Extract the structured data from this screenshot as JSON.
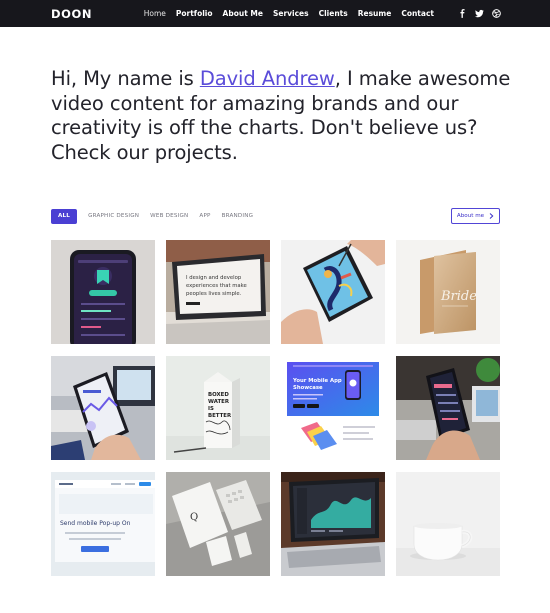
{
  "brand": {
    "logo": "DOON"
  },
  "nav": {
    "links": [
      "Home",
      "Portfolio",
      "About Me",
      "Services",
      "Clients",
      "Resume",
      "Contact"
    ],
    "social": [
      "facebook-icon",
      "twitter-icon",
      "dribbble-icon"
    ]
  },
  "hero": {
    "prefix": "Hi, My name is ",
    "name": "David Andrew",
    "suffix": ", I make awesome video content for amazing brands and our creativity is off the charts. Don't believe us? Check our projects."
  },
  "filters": {
    "items": [
      "ALL",
      "GRAPHIC DESIGN",
      "WEB DESIGN",
      "APP",
      "BRANDING"
    ],
    "active": "ALL"
  },
  "about_button": {
    "label": "About me",
    "icon": "chevron-right-icon"
  },
  "portfolio": {
    "tiles": [
      {
        "subject": "phone-app-dark"
      },
      {
        "subject": "laptop-quote",
        "screen_text": [
          "I design and develop",
          "experiences that make",
          "peoples lives simple."
        ]
      },
      {
        "subject": "tablet-drawing"
      },
      {
        "subject": "bride-card",
        "card_text": "Bride"
      },
      {
        "subject": "phone-in-hand-chart"
      },
      {
        "subject": "milk-carton",
        "carton_text": [
          "BOXED",
          "WATER",
          "IS",
          "BETTER"
        ]
      },
      {
        "subject": "mobile-app-showcase",
        "heading": [
          "Your Mobile App",
          "Showcase"
        ]
      },
      {
        "subject": "phone-in-hand-dark"
      },
      {
        "subject": "web-mockup-popup",
        "headline": "Send mobile Pop-up On"
      },
      {
        "subject": "stationery-mockup",
        "letter": "Q"
      },
      {
        "subject": "laptop-dashboard"
      },
      {
        "subject": "white-mug"
      }
    ]
  },
  "colors": {
    "nav_bg": "#17171c",
    "accent": "#4a3fd3",
    "link": "#5a4cd9",
    "text": "#23232b"
  }
}
